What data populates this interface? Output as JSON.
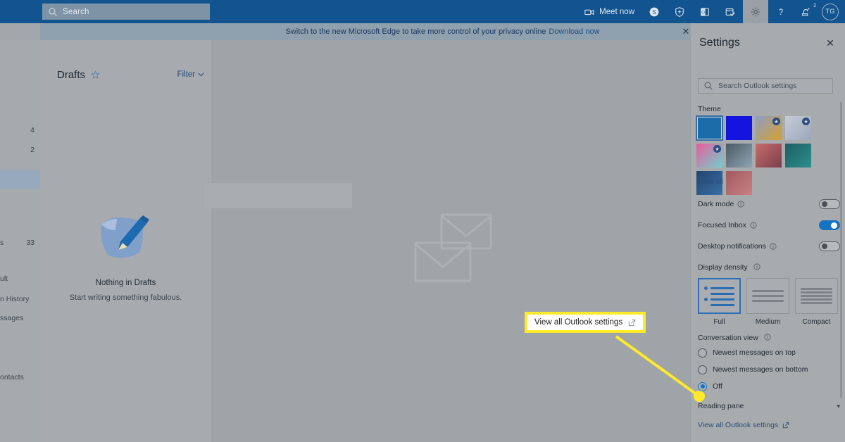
{
  "suite_bar": {
    "search": {
      "placeholder": "Search",
      "icon": "search-icon"
    },
    "meet_now": {
      "label": "Meet now",
      "icon": "video-camera-icon"
    },
    "skype": {
      "icon": "skype-icon"
    },
    "security": {
      "icon": "shield-icon"
    },
    "outlook_app": {
      "icon": "outlook-app-icon"
    },
    "calendar": {
      "icon": "calendar-check-icon"
    },
    "settings": {
      "icon": "gear-icon"
    },
    "help": {
      "icon": "question-mark-icon"
    },
    "feedback": {
      "icon": "feedback-icon",
      "badge": "2"
    },
    "avatar": {
      "initials": "TG"
    }
  },
  "edge_banner": {
    "text": "Switch to the new Microsoft Edge to take more control of your privacy online",
    "link": "Download now",
    "close": "✕"
  },
  "left_rail": {
    "counts": [
      "4",
      "2"
    ],
    "truncated_items": [
      {
        "label": "s",
        "count": "33"
      },
      {
        "label": "ult"
      },
      {
        "label": "n History"
      },
      {
        "label": "ssages"
      },
      {
        "label": "ontacts"
      }
    ]
  },
  "message_list": {
    "title": "Drafts",
    "star_icon": "star-icon",
    "filter": {
      "label": "Filter",
      "icon": "chevron-down-icon"
    },
    "empty_state": {
      "illustration": "draft-paper-pencil-icon",
      "heading": "Nothing in Drafts",
      "subtext": "Start writing something fabulous."
    }
  },
  "reading_pane": {
    "illustration": "envelopes-icon"
  },
  "settings_panel": {
    "title": "Settings",
    "close_icon": "close-icon",
    "search": {
      "placeholder": "Search Outlook settings",
      "icon": "search-icon"
    },
    "theme": {
      "label": "Theme",
      "view_all": "View all",
      "swatches": [
        {
          "name": "solid-blue-selected",
          "colors": [
            "#1b6ca8",
            "#1b6ca8"
          ],
          "premium": false,
          "selected": true
        },
        {
          "name": "solid-dark-blue",
          "colors": [
            "#1414e0",
            "#1414e0"
          ],
          "premium": false,
          "selected": false
        },
        {
          "name": "sunset-stripes",
          "colors": [
            "#8e9ec7",
            "#d4a02e"
          ],
          "premium": true,
          "selected": false
        },
        {
          "name": "feather-pastel",
          "colors": [
            "#c6ccd6",
            "#9aa7bb"
          ],
          "premium": true,
          "selected": false
        },
        {
          "name": "rainbow-unicorn",
          "colors": [
            "#e85d9c",
            "#6fd0cf"
          ],
          "premium": true,
          "selected": false
        },
        {
          "name": "mountain-landscape",
          "colors": [
            "#4a5a63",
            "#8fa4b4"
          ],
          "premium": false,
          "selected": false
        },
        {
          "name": "palm-sunset",
          "colors": [
            "#c96c6c",
            "#7a3f4c"
          ],
          "premium": false,
          "selected": false
        },
        {
          "name": "teal-circuit",
          "colors": [
            "#1d5f63",
            "#2e8f8a"
          ],
          "premium": false,
          "selected": false
        },
        {
          "name": "blue-circuit",
          "colors": [
            "#23456e",
            "#3a6ea5"
          ],
          "premium": false,
          "selected": false
        },
        {
          "name": "red-bokeh",
          "colors": [
            "#a05a5e",
            "#c98084"
          ],
          "premium": false,
          "selected": false
        }
      ]
    },
    "toggles": [
      {
        "label": "Dark mode",
        "info_icon": "info-icon",
        "on": false
      },
      {
        "label": "Focused Inbox",
        "info_icon": "info-icon",
        "on": true
      },
      {
        "label": "Desktop notifications",
        "info_icon": "info-icon",
        "on": false
      }
    ],
    "display_density": {
      "label": "Display density",
      "info_icon": "info-icon",
      "options": [
        {
          "label": "Full",
          "selected": true
        },
        {
          "label": "Medium",
          "selected": false
        },
        {
          "label": "Compact",
          "selected": false
        }
      ]
    },
    "conversation_view": {
      "label": "Conversation view",
      "info_icon": "info-icon",
      "options": [
        {
          "label": "Newest messages on top",
          "selected": false
        },
        {
          "label": "Newest messages on bottom",
          "selected": false
        },
        {
          "label": "Off",
          "selected": true
        }
      ]
    },
    "reading_pane": {
      "label": "Reading pane",
      "chevron_icon": "chevron-down-icon"
    },
    "view_all_link": {
      "label": "View all Outlook settings",
      "icon": "open-in-new-icon"
    }
  },
  "annotation": {
    "callout": {
      "label": "View all Outlook settings",
      "icon": "open-in-new-icon"
    },
    "highlight_color": "#ffe92b"
  },
  "colors": {
    "suite_bar": "#12548f",
    "accent": "#1673c4",
    "highlight": "#ffe92b",
    "panel_bg": "#a7abae"
  }
}
